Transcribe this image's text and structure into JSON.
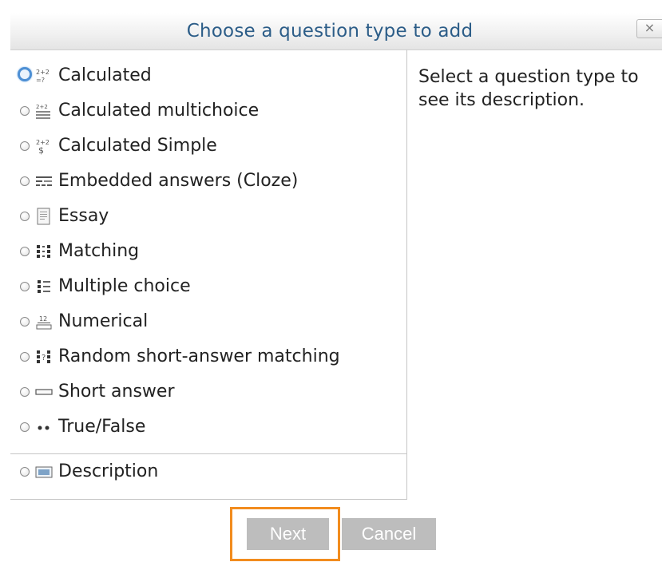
{
  "dialog": {
    "title": "Choose a question type to add",
    "close_label": "×",
    "description_placeholder": "Select a question type to see its description."
  },
  "question_types": [
    {
      "label": "Calculated",
      "icon": "calculated-icon",
      "selected": true
    },
    {
      "label": "Calculated multichoice",
      "icon": "calculated-multichoice-icon",
      "selected": false
    },
    {
      "label": "Calculated Simple",
      "icon": "calculated-simple-icon",
      "selected": false
    },
    {
      "label": "Embedded answers (Cloze)",
      "icon": "cloze-icon",
      "selected": false
    },
    {
      "label": "Essay",
      "icon": "essay-icon",
      "selected": false
    },
    {
      "label": "Matching",
      "icon": "matching-icon",
      "selected": false
    },
    {
      "label": "Multiple choice",
      "icon": "multiple-choice-icon",
      "selected": false
    },
    {
      "label": "Numerical",
      "icon": "numerical-icon",
      "selected": false
    },
    {
      "label": "Random short-answer matching",
      "icon": "random-short-answer-matching-icon",
      "selected": false
    },
    {
      "label": "Short answer",
      "icon": "short-answer-icon",
      "selected": false
    },
    {
      "label": "True/False",
      "icon": "true-false-icon",
      "selected": false
    }
  ],
  "other_types": [
    {
      "label": "Description",
      "icon": "description-icon",
      "selected": false
    }
  ],
  "footer": {
    "next_label": "Next",
    "cancel_label": "Cancel"
  },
  "colors": {
    "title": "#2c5d88",
    "highlight": "#f28c1e",
    "button": "#bdbdbd",
    "radio_selected": "#4d8fd4"
  }
}
